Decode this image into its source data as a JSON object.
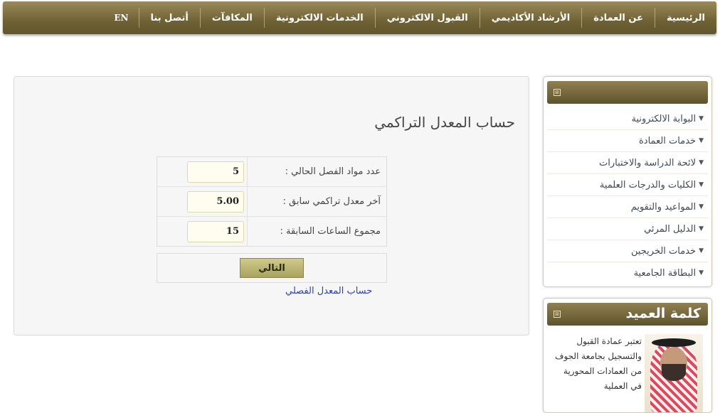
{
  "nav": {
    "items": [
      "الرئيسية",
      "عن العمادة",
      "الأرشاد الأكاديمي",
      "القبول الالكتروني",
      "الخدمات الالكترونية",
      "المكافآت",
      "أتصل بنا"
    ],
    "lang": "EN"
  },
  "sidebar": {
    "items": [
      "البوابة الالكترونية",
      "خدمات العمادة",
      "لائحة الدراسة والاختبارات",
      "الكليات والدرجات العلمية",
      "المواعيد والتقويم",
      "الدليل المرئي",
      "خدمات الخريجين",
      "البطاقة الجامعية"
    ]
  },
  "dean": {
    "title": "كلمة العميد",
    "text": "تعتبر عمادة القبول والتسجيل بجامعة الجوف من العمادات المحورية في العملية"
  },
  "main": {
    "title": "حساب المعدل التراكمي",
    "fields": [
      {
        "label": "عدد مواد الفصل الحالي :",
        "value": "5"
      },
      {
        "label": "آخر معدل تراكمي سابق :",
        "value": "5.00"
      },
      {
        "label": "مجموع الساعات السابقة :",
        "value": "15"
      }
    ],
    "next_label": "التالي",
    "link_label": "حساب المعدل الفصلي"
  },
  "icons": {
    "collapse": "collapse-icon",
    "bullet": "bullet-icon"
  },
  "colors": {
    "brand": "#6f6235",
    "button": "#bdb774",
    "link": "#2e3fae"
  }
}
